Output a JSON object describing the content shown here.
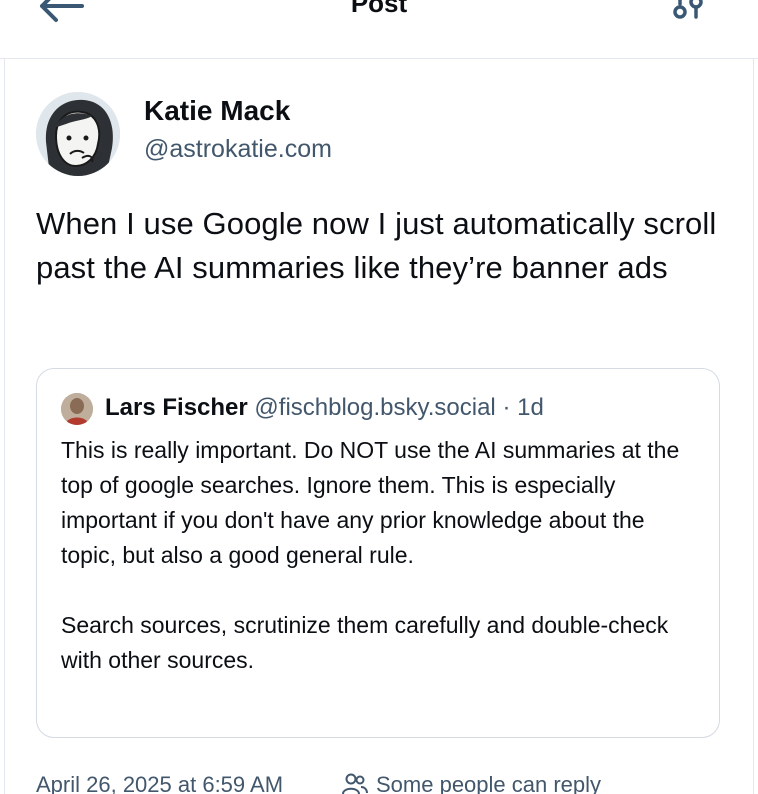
{
  "header": {
    "title": "Post",
    "back_icon": "arrow-left-icon",
    "settings_icon": "sliders-icon"
  },
  "author": {
    "name": "Katie Mack",
    "handle": "@astrokatie.com",
    "avatar_icon": "avatar-cartoon-face"
  },
  "post": {
    "text": "When I use Google now I just automatically scroll past the AI summaries like they’re banner ads"
  },
  "quote": {
    "name": "Lars Fischer",
    "handle": "@fischblog.bsky.social",
    "time": "· 1d",
    "paragraphs": [
      "This is really important. Do NOT use the AI summaries at the top of google searches. Ignore them. This is especially important if you don't have any prior knowledge about the topic, but also a good general rule.",
      "Search sources, scrutinize them carefully and double-check with other sources."
    ]
  },
  "meta": {
    "timestamp": "April 26, 2025 at 6:59 AM",
    "reply_setting": "Some people can reply",
    "reply_icon": "people-icon"
  },
  "colors": {
    "text": "#0b0f14",
    "muted": "#42576c",
    "border": "#d4dbe2",
    "accent": "#1083fe"
  }
}
